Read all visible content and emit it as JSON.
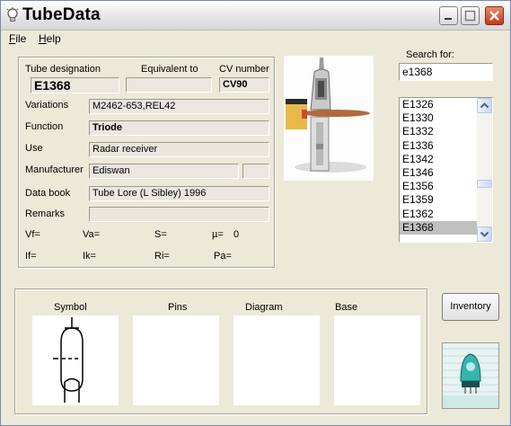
{
  "window": {
    "title": "TubeData",
    "icon": "lightbulb-icon",
    "controls": [
      "minimize-icon",
      "maximize-icon",
      "close-icon"
    ]
  },
  "menu": {
    "file": {
      "mnemonic": "F",
      "rest": "ile"
    },
    "help": {
      "mnemonic": "H",
      "rest": "elp"
    }
  },
  "details": {
    "tube_designation_label": "Tube designation",
    "tube_designation": "E1368",
    "equivalent_label": "Equivalent to",
    "equivalent": "",
    "cv_label": "CV number",
    "cv": "CV90",
    "variations_label": "Variations",
    "variations": "M2462-653,REL42",
    "function_label": "Function",
    "function": "Triode",
    "use_label": "Use",
    "use": "Radar receiver",
    "manufacturer_label": "Manufacturer",
    "manufacturer": "Ediswan",
    "manufacturer_extra": "",
    "databook_label": "Data book",
    "databook": "Tube Lore (L Sibley) 1996",
    "remarks_label": "Remarks",
    "remarks": "",
    "params": {
      "vf": "Vf=",
      "va": "Va=",
      "s": "S=",
      "mu": "µ=",
      "mu_value": "0",
      "if": "If=",
      "ik": "Ik=",
      "ri": "Ri=",
      "pa": "Pa="
    }
  },
  "search": {
    "label": "Search for:",
    "value": "e1368",
    "results": [
      "E1326",
      "E1330",
      "E1332",
      "E1336",
      "E1342",
      "E1346",
      "E1356",
      "E1359",
      "E1362",
      "E1368"
    ],
    "selected": "E1368",
    "scroll_icons": [
      "scroll-up-icon",
      "scroll-down-icon"
    ]
  },
  "panels": {
    "symbol": "Symbol",
    "pins": "Pins",
    "diagram": "Diagram",
    "base": "Base"
  },
  "inventory_label": "Inventory",
  "colors": {
    "window_bg": "#ece9d8",
    "field_bg": "#e9e7de",
    "selection_bg": "#c0c0c0",
    "close_button": "#c2381a"
  }
}
